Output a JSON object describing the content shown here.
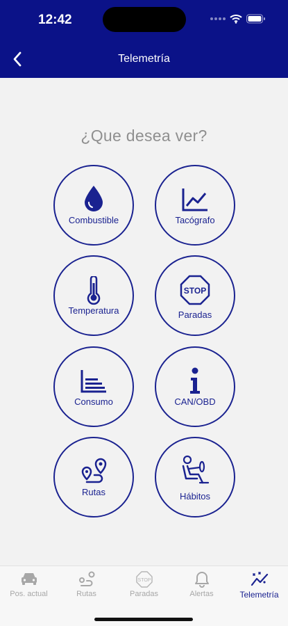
{
  "status_bar": {
    "time": "12:42"
  },
  "nav": {
    "title": "Telemetría"
  },
  "prompt": "¿Que desea ver?",
  "tiles": [
    {
      "label": "Combustible",
      "icon": "fuel-drop-icon"
    },
    {
      "label": "Tacógrafo",
      "icon": "line-chart-icon"
    },
    {
      "label": "Temperatura",
      "icon": "thermometer-icon"
    },
    {
      "label": "Paradas",
      "icon": "stop-sign-icon"
    },
    {
      "label": "Consumo",
      "icon": "bar-chart-icon"
    },
    {
      "label": "CAN/OBD",
      "icon": "info-icon"
    },
    {
      "label": "Rutas",
      "icon": "route-icon"
    },
    {
      "label": "Hábitos",
      "icon": "driver-icon"
    }
  ],
  "tabs": [
    {
      "label": "Pos. actual",
      "icon": "car-icon",
      "active": false
    },
    {
      "label": "Rutas",
      "icon": "route-icon",
      "active": false
    },
    {
      "label": "Paradas",
      "icon": "stop-sign-icon",
      "active": false
    },
    {
      "label": "Alertas",
      "icon": "bell-icon",
      "active": false
    },
    {
      "label": "Telemetría",
      "icon": "telemetry-icon",
      "active": true
    }
  ],
  "colors": {
    "header": "#0b1288",
    "accent": "#1a2290",
    "inactive": "#a7a7a7",
    "background": "#f2f2f2"
  }
}
